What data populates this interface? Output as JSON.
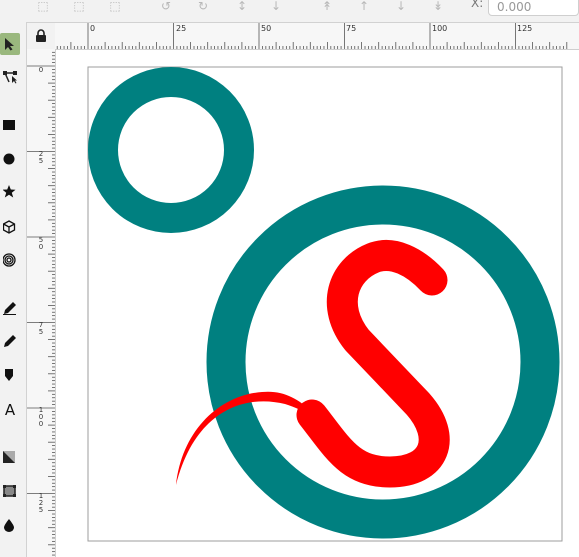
{
  "toolbar": {
    "x_label": "X:",
    "x_value": "0.000",
    "icons": [
      "select-all-icon",
      "select-all-in-all-layers-icon",
      "deselect-icon",
      "rotate-ccw-icon",
      "rotate-cw-icon",
      "flip-horizontal-icon",
      "flip-vertical-icon",
      "raise-to-top-icon",
      "raise-icon",
      "lower-icon",
      "lower-to-bottom-icon"
    ]
  },
  "tools": [
    {
      "name": "selector-tool",
      "icon": "arrow-pointer-icon",
      "active": true
    },
    {
      "name": "node-tool",
      "icon": "node-edit-icon"
    },
    {
      "name": "rectangle-tool",
      "icon": "rectangle-icon"
    },
    {
      "name": "ellipse-tool",
      "icon": "circle-icon"
    },
    {
      "name": "star-tool",
      "icon": "star-icon"
    },
    {
      "name": "box3d-tool",
      "icon": "cube-icon"
    },
    {
      "name": "spiral-tool",
      "icon": "spiral-icon"
    },
    {
      "name": "pencil-tool",
      "icon": "pencil-icon"
    },
    {
      "name": "pen-tool",
      "icon": "pen-icon"
    },
    {
      "name": "calligraphy-tool",
      "icon": "calligraphy-icon"
    },
    {
      "name": "text-tool",
      "icon": "text-icon",
      "glyph": "A"
    },
    {
      "name": "gradient-tool",
      "icon": "gradient-icon"
    },
    {
      "name": "mesh-tool",
      "icon": "mesh-icon"
    },
    {
      "name": "dropper-tool",
      "icon": "dropper-icon"
    }
  ],
  "ruler": {
    "horizontal_labels": [
      "0",
      "25",
      "50",
      "75",
      "100",
      "125"
    ],
    "vertical_labels": [
      [
        "0"
      ],
      [
        "2",
        "5"
      ],
      [
        "5",
        "0"
      ],
      [
        "7",
        "5"
      ],
      [
        "1",
        "0",
        "0"
      ],
      [
        "1",
        "2",
        "5"
      ]
    ]
  },
  "artwork": {
    "ring_color": "#008080",
    "s_color": "#ff0000",
    "page_border_color": "#9e9e9e"
  }
}
